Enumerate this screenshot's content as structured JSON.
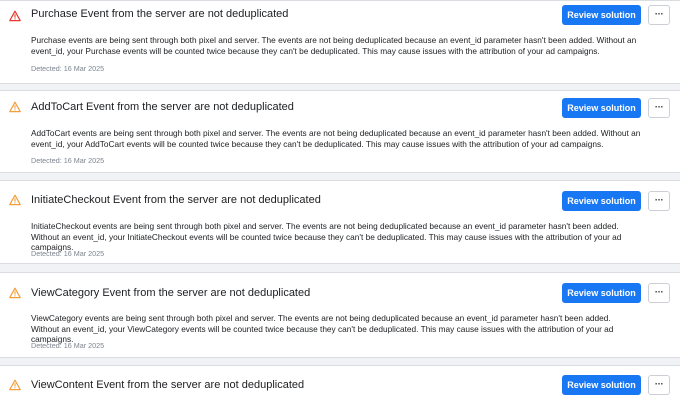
{
  "colors": {
    "error_icon": "#e5382f",
    "warning_icon": "#f29e3c",
    "button_primary": "#1877f2"
  },
  "issues": [
    {
      "severity": "error",
      "icon": "warning-triangle-icon",
      "title": "Purchase Event from the server are not deduplicated",
      "description": "Purchase events are being sent through both pixel and server. The events are not being deduplicated because an event_id parameter hasn't been added. Without an event_id, your Purchase events will be counted twice because they can't be deduplicated. This may cause issues with the attribution of your ad campaigns.",
      "detected": "Detected: 16 Mar 2025",
      "review_label": "Review solution",
      "more_label": "···"
    },
    {
      "severity": "warning",
      "icon": "warning-triangle-icon",
      "title": "AddToCart Event from the server are not deduplicated",
      "description": "AddToCart events are being sent through both pixel and server. The events are not being deduplicated because an event_id parameter hasn't been added. Without an event_id, your AddToCart events will be counted twice because they can't be deduplicated. This may cause issues with the attribution of your ad campaigns.",
      "detected": "Detected: 16 Mar 2025",
      "review_label": "Review solution",
      "more_label": "···"
    },
    {
      "severity": "warning",
      "icon": "warning-triangle-icon",
      "title": "InitiateCheckout Event from the server are not deduplicated",
      "description": "InitiateCheckout events are being sent through both pixel and server. The events are not being deduplicated because an event_id parameter hasn't been added. Without an event_id, your InitiateCheckout events will be counted twice because they can't be deduplicated. This may cause issues with the attribution of your ad campaigns.",
      "detected": "Detected: 16 Mar 2025",
      "review_label": "Review solution",
      "more_label": "···"
    },
    {
      "severity": "warning",
      "icon": "warning-triangle-icon",
      "title": "ViewCategory Event from the server are not deduplicated",
      "description": "ViewCategory events are being sent through both pixel and server. The events are not being deduplicated because an event_id parameter hasn't been added. Without an event_id, your ViewCategory events will be counted twice because they can't be deduplicated. This may cause issues with the attribution of your ad campaigns.",
      "detected": "Detected: 16 Mar 2025",
      "review_label": "Review solution",
      "more_label": "···"
    },
    {
      "severity": "warning",
      "icon": "warning-triangle-icon",
      "title": "ViewContent Event from the server are not deduplicated",
      "review_label": "Review solution",
      "more_label": "···"
    }
  ]
}
